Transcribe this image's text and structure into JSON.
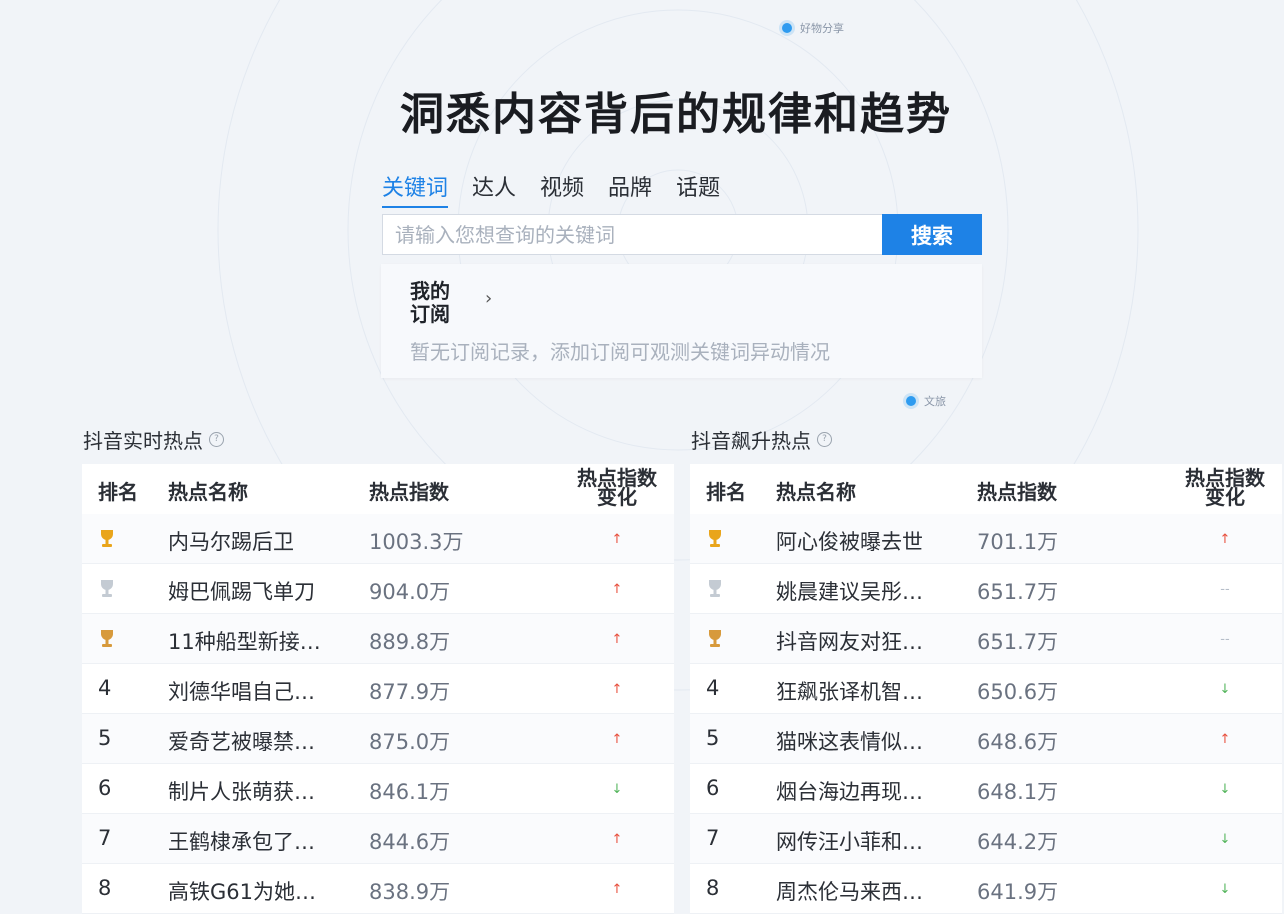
{
  "hero": {
    "title": "洞悉内容背后的规律和趋势",
    "tag_top": "好物分享",
    "tag_mid": "文旅"
  },
  "search": {
    "tabs": [
      "关键词",
      "达人",
      "视频",
      "品牌",
      "话题"
    ],
    "active_tab": "关键词",
    "placeholder": "请输入您想查询的关键词",
    "value": "",
    "button_label": "搜索"
  },
  "subscription": {
    "title_line1": "我的",
    "title_line2": "订阅",
    "chevron": "›",
    "empty_text": "暂无订阅记录，添加订阅可观测关键词异动情况"
  },
  "columns": {
    "rank": "排名",
    "name": "热点名称",
    "index": "热点指数",
    "change_line1": "热点指数",
    "change_line2": "变化"
  },
  "icons": {
    "help": "question-circle-icon",
    "gold": "gold-trophy-icon",
    "silver": "silver-trophy-icon",
    "bronze": "bronze-trophy-icon",
    "up": "trend-up-arrow-icon",
    "down": "trend-down-arrow-icon",
    "flat": "trend-flat-icon"
  },
  "colors": {
    "accent": "#1e82e6",
    "up": "#e84f3d",
    "down": "#52b45a",
    "gold": "#e9a51b",
    "silver": "#c4cbd3",
    "bronze": "#d79a3c"
  },
  "realtime": {
    "title": "抖音实时热点",
    "help": "?",
    "rows": [
      {
        "rank": "",
        "medal": "gold",
        "name": "内马尔踢后卫",
        "index": "1003.3万",
        "trend": "up"
      },
      {
        "rank": "",
        "medal": "silver",
        "name": "姆巴佩踢飞单刀",
        "index": "904.0万",
        "trend": "up"
      },
      {
        "rank": "",
        "medal": "bronze",
        "name": "11种船型新接…",
        "index": "889.8万",
        "trend": "up"
      },
      {
        "rank": "4",
        "medal": "",
        "name": "刘德华唱自己…",
        "index": "877.9万",
        "trend": "up"
      },
      {
        "rank": "5",
        "medal": "",
        "name": "爱奇艺被曝禁…",
        "index": "875.0万",
        "trend": "up"
      },
      {
        "rank": "6",
        "medal": "",
        "name": "制片人张萌获…",
        "index": "846.1万",
        "trend": "down"
      },
      {
        "rank": "7",
        "medal": "",
        "name": "王鹤棣承包了…",
        "index": "844.6万",
        "trend": "up"
      },
      {
        "rank": "8",
        "medal": "",
        "name": "高铁G61为她…",
        "index": "838.9万",
        "trend": "up"
      }
    ]
  },
  "rising": {
    "title": "抖音飙升热点",
    "help": "?",
    "rows": [
      {
        "rank": "",
        "medal": "gold",
        "name": "阿心俊被曝去世",
        "index": "701.1万",
        "trend": "up"
      },
      {
        "rank": "",
        "medal": "silver",
        "name": "姚晨建议吴彤…",
        "index": "651.7万",
        "trend": "flat"
      },
      {
        "rank": "",
        "medal": "bronze",
        "name": "抖音网友对狂…",
        "index": "651.7万",
        "trend": "flat"
      },
      {
        "rank": "4",
        "medal": "",
        "name": "狂飙张译机智…",
        "index": "650.6万",
        "trend": "down"
      },
      {
        "rank": "5",
        "medal": "",
        "name": "猫咪这表情似…",
        "index": "648.6万",
        "trend": "up"
      },
      {
        "rank": "6",
        "medal": "",
        "name": "烟台海边再现…",
        "index": "648.1万",
        "trend": "down"
      },
      {
        "rank": "7",
        "medal": "",
        "name": "网传汪小菲和…",
        "index": "644.2万",
        "trend": "down"
      },
      {
        "rank": "8",
        "medal": "",
        "name": "周杰伦马来西…",
        "index": "641.9万",
        "trend": "down"
      }
    ]
  }
}
